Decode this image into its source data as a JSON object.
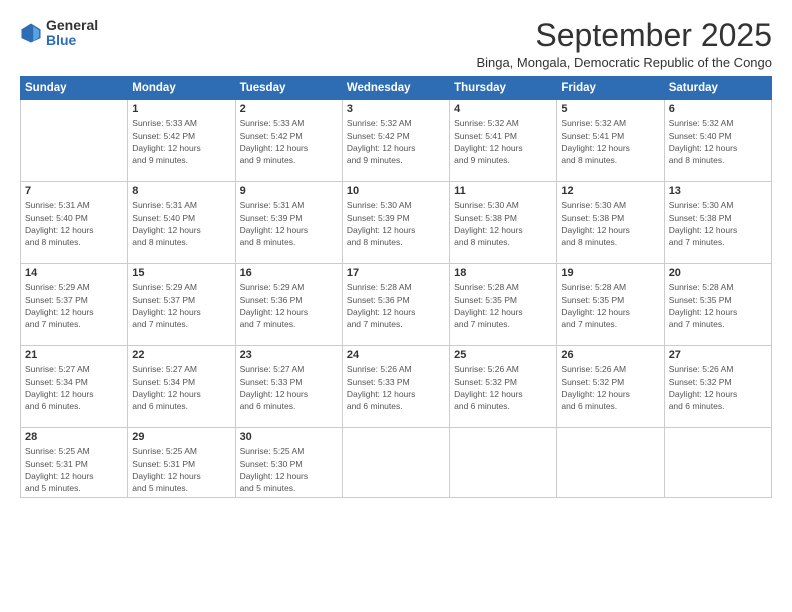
{
  "logo": {
    "general": "General",
    "blue": "Blue"
  },
  "title": "September 2025",
  "subtitle": "Binga, Mongala, Democratic Republic of the Congo",
  "days_of_week": [
    "Sunday",
    "Monday",
    "Tuesday",
    "Wednesday",
    "Thursday",
    "Friday",
    "Saturday"
  ],
  "weeks": [
    [
      {
        "day": "",
        "detail": ""
      },
      {
        "day": "1",
        "detail": "Sunrise: 5:33 AM\nSunset: 5:42 PM\nDaylight: 12 hours\nand 9 minutes."
      },
      {
        "day": "2",
        "detail": "Sunrise: 5:33 AM\nSunset: 5:42 PM\nDaylight: 12 hours\nand 9 minutes."
      },
      {
        "day": "3",
        "detail": "Sunrise: 5:32 AM\nSunset: 5:42 PM\nDaylight: 12 hours\nand 9 minutes."
      },
      {
        "day": "4",
        "detail": "Sunrise: 5:32 AM\nSunset: 5:41 PM\nDaylight: 12 hours\nand 9 minutes."
      },
      {
        "day": "5",
        "detail": "Sunrise: 5:32 AM\nSunset: 5:41 PM\nDaylight: 12 hours\nand 8 minutes."
      },
      {
        "day": "6",
        "detail": "Sunrise: 5:32 AM\nSunset: 5:40 PM\nDaylight: 12 hours\nand 8 minutes."
      }
    ],
    [
      {
        "day": "7",
        "detail": "Sunrise: 5:31 AM\nSunset: 5:40 PM\nDaylight: 12 hours\nand 8 minutes."
      },
      {
        "day": "8",
        "detail": "Sunrise: 5:31 AM\nSunset: 5:40 PM\nDaylight: 12 hours\nand 8 minutes."
      },
      {
        "day": "9",
        "detail": "Sunrise: 5:31 AM\nSunset: 5:39 PM\nDaylight: 12 hours\nand 8 minutes."
      },
      {
        "day": "10",
        "detail": "Sunrise: 5:30 AM\nSunset: 5:39 PM\nDaylight: 12 hours\nand 8 minutes."
      },
      {
        "day": "11",
        "detail": "Sunrise: 5:30 AM\nSunset: 5:38 PM\nDaylight: 12 hours\nand 8 minutes."
      },
      {
        "day": "12",
        "detail": "Sunrise: 5:30 AM\nSunset: 5:38 PM\nDaylight: 12 hours\nand 8 minutes."
      },
      {
        "day": "13",
        "detail": "Sunrise: 5:30 AM\nSunset: 5:38 PM\nDaylight: 12 hours\nand 7 minutes."
      }
    ],
    [
      {
        "day": "14",
        "detail": "Sunrise: 5:29 AM\nSunset: 5:37 PM\nDaylight: 12 hours\nand 7 minutes."
      },
      {
        "day": "15",
        "detail": "Sunrise: 5:29 AM\nSunset: 5:37 PM\nDaylight: 12 hours\nand 7 minutes."
      },
      {
        "day": "16",
        "detail": "Sunrise: 5:29 AM\nSunset: 5:36 PM\nDaylight: 12 hours\nand 7 minutes."
      },
      {
        "day": "17",
        "detail": "Sunrise: 5:28 AM\nSunset: 5:36 PM\nDaylight: 12 hours\nand 7 minutes."
      },
      {
        "day": "18",
        "detail": "Sunrise: 5:28 AM\nSunset: 5:35 PM\nDaylight: 12 hours\nand 7 minutes."
      },
      {
        "day": "19",
        "detail": "Sunrise: 5:28 AM\nSunset: 5:35 PM\nDaylight: 12 hours\nand 7 minutes."
      },
      {
        "day": "20",
        "detail": "Sunrise: 5:28 AM\nSunset: 5:35 PM\nDaylight: 12 hours\nand 7 minutes."
      }
    ],
    [
      {
        "day": "21",
        "detail": "Sunrise: 5:27 AM\nSunset: 5:34 PM\nDaylight: 12 hours\nand 6 minutes."
      },
      {
        "day": "22",
        "detail": "Sunrise: 5:27 AM\nSunset: 5:34 PM\nDaylight: 12 hours\nand 6 minutes."
      },
      {
        "day": "23",
        "detail": "Sunrise: 5:27 AM\nSunset: 5:33 PM\nDaylight: 12 hours\nand 6 minutes."
      },
      {
        "day": "24",
        "detail": "Sunrise: 5:26 AM\nSunset: 5:33 PM\nDaylight: 12 hours\nand 6 minutes."
      },
      {
        "day": "25",
        "detail": "Sunrise: 5:26 AM\nSunset: 5:32 PM\nDaylight: 12 hours\nand 6 minutes."
      },
      {
        "day": "26",
        "detail": "Sunrise: 5:26 AM\nSunset: 5:32 PM\nDaylight: 12 hours\nand 6 minutes."
      },
      {
        "day": "27",
        "detail": "Sunrise: 5:26 AM\nSunset: 5:32 PM\nDaylight: 12 hours\nand 6 minutes."
      }
    ],
    [
      {
        "day": "28",
        "detail": "Sunrise: 5:25 AM\nSunset: 5:31 PM\nDaylight: 12 hours\nand 5 minutes."
      },
      {
        "day": "29",
        "detail": "Sunrise: 5:25 AM\nSunset: 5:31 PM\nDaylight: 12 hours\nand 5 minutes."
      },
      {
        "day": "30",
        "detail": "Sunrise: 5:25 AM\nSunset: 5:30 PM\nDaylight: 12 hours\nand 5 minutes."
      },
      {
        "day": "",
        "detail": ""
      },
      {
        "day": "",
        "detail": ""
      },
      {
        "day": "",
        "detail": ""
      },
      {
        "day": "",
        "detail": ""
      }
    ]
  ]
}
